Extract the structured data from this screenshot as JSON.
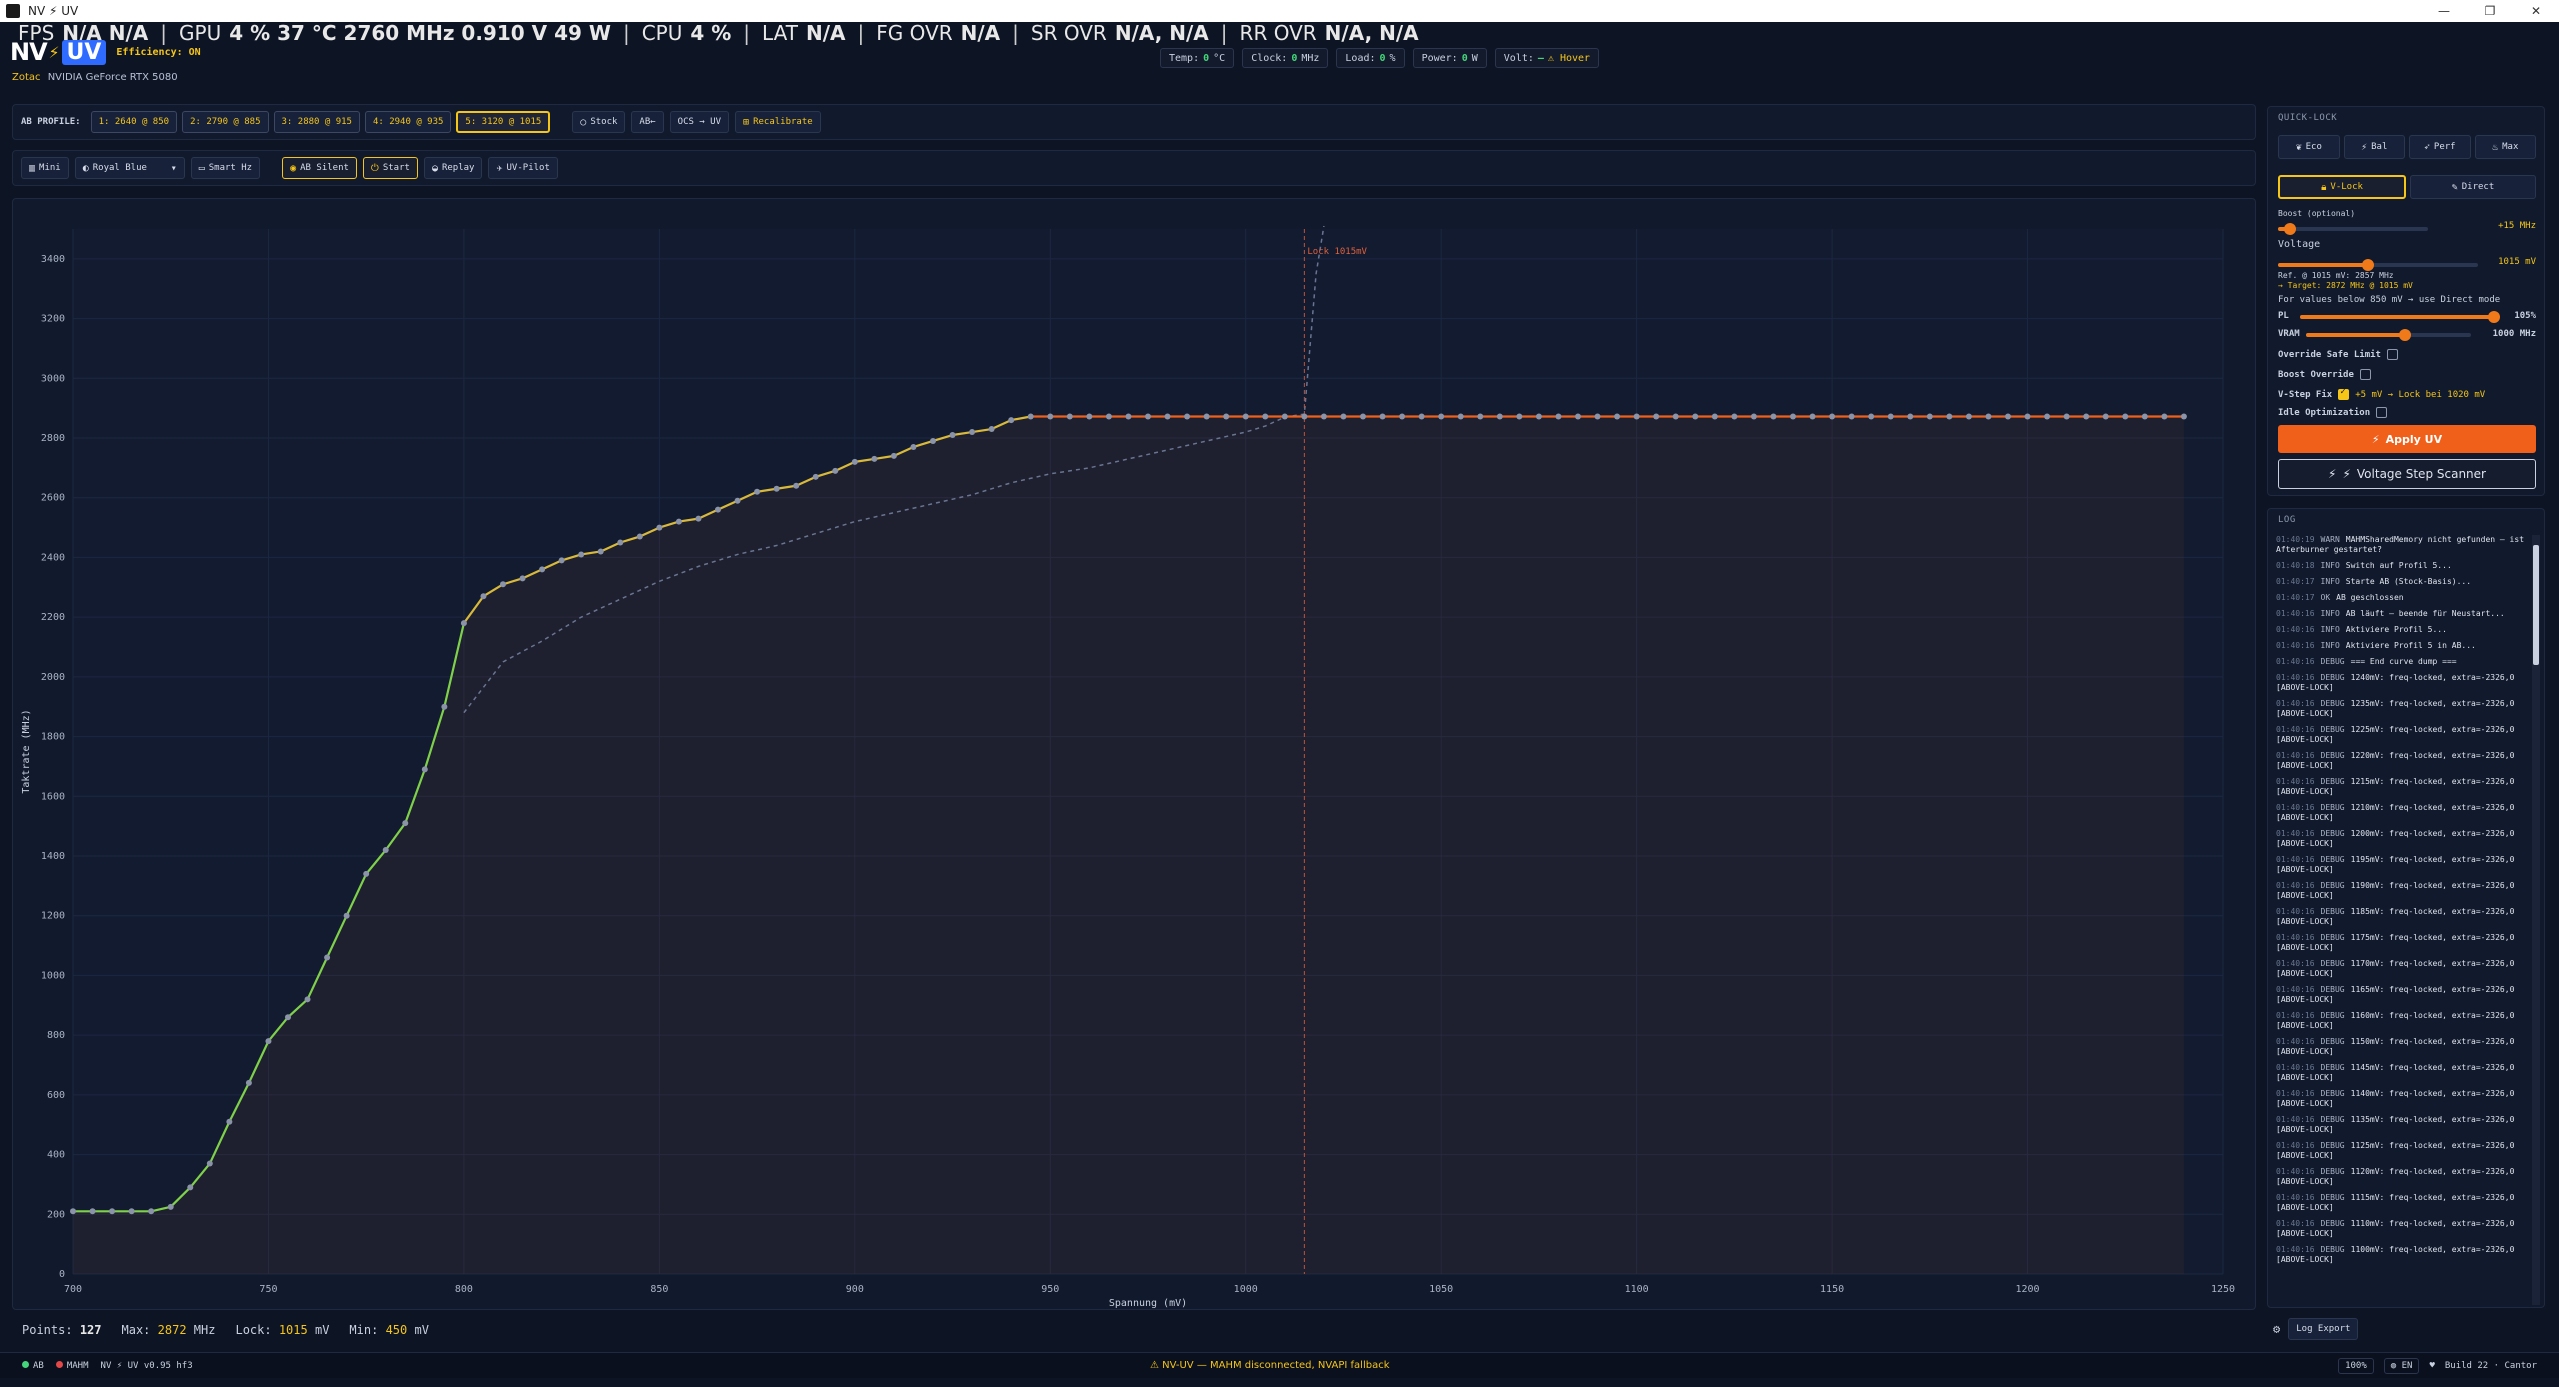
{
  "window": {
    "title": "NV ⚡ UV",
    "controls": [
      "—",
      "❐",
      "✕"
    ]
  },
  "osd": [
    {
      "label": "FPS",
      "value": "N/A  N/A"
    },
    {
      "label": "GPU",
      "value": "4 %  37 °C  2760 MHz  0.910 V  49 W"
    },
    {
      "label": "CPU",
      "value": "4 %"
    },
    {
      "label": "LAT",
      "value": "N/A"
    },
    {
      "label": "FG OVR",
      "value": "N/A"
    },
    {
      "label": "SR OVR",
      "value": "N/A, N/A"
    },
    {
      "label": "RR OVR",
      "value": "N/A, N/A"
    }
  ],
  "brand": {
    "nv": "NV",
    "bolt": "⚡",
    "uv": "UV",
    "efficiency": "Efficiency: ON",
    "vendor": "Zotac",
    "gpu": "NVIDIA GeForce RTX 5080"
  },
  "stats": [
    {
      "label": "Temp:",
      "value": "0",
      "unit": "°C"
    },
    {
      "label": "Clock:",
      "value": "0",
      "unit": "MHz"
    },
    {
      "label": "Load:",
      "value": "0",
      "unit": "%"
    },
    {
      "label": "Power:",
      "value": "0",
      "unit": "W"
    },
    {
      "label": "Volt:",
      "value": "—",
      "unit": "⚠ Hover"
    }
  ],
  "toolbar1": {
    "label": "AB PROFILE:",
    "profiles": [
      "1: 2640 @ 850",
      "2: 2790 @ 885",
      "3: 2880 @ 915",
      "4: 2940 @ 935",
      "5: 3120 @ 1015"
    ],
    "active_profile": 4,
    "stock": "Stock",
    "ab_arrow": "AB←",
    "ocs_uv": "OCS → UV",
    "recalibrate": "Recalibrate"
  },
  "toolbar2": {
    "mini": "Mini",
    "theme": "Royal Blue",
    "smart_hz": "Smart Hz",
    "ab_silent": "AB Silent",
    "start": "Start",
    "replay": "Replay",
    "uv_pilot": "UV-Pilot"
  },
  "chart_data": {
    "type": "line",
    "xlabel": "Spannung (mV)",
    "ylabel": "Taktrate (MHz)",
    "xlim": [
      700,
      1250
    ],
    "ylim": [
      0,
      3500
    ],
    "xticks": [
      700,
      750,
      800,
      850,
      900,
      950,
      1000,
      1050,
      1100,
      1150,
      1200,
      1250
    ],
    "yticks": [
      0,
      200,
      400,
      600,
      800,
      1000,
      1200,
      1400,
      1600,
      1800,
      2000,
      2200,
      2400,
      2600,
      2800,
      3000,
      3200,
      3400
    ],
    "lock_label": "Lock 1015mV",
    "lock_mv": 1015,
    "series": [
      {
        "x": [
          700,
          705,
          710,
          715,
          720,
          725,
          730,
          735,
          740,
          745,
          750,
          755,
          760,
          765,
          770,
          775,
          780,
          785,
          790,
          795,
          800,
          805,
          810,
          815,
          820,
          825,
          830,
          835,
          840,
          845,
          850,
          855,
          860,
          865,
          870,
          875,
          880,
          885,
          890,
          895,
          900,
          905,
          910,
          915,
          920,
          925,
          930,
          935,
          940,
          945,
          950,
          955,
          960,
          965,
          970,
          975,
          980,
          985,
          990,
          995,
          1000,
          1005,
          1010,
          1015,
          1020,
          1025,
          1030,
          1035,
          1040,
          1045,
          1050,
          1055,
          1060,
          1065,
          1070,
          1075,
          1080,
          1085,
          1090,
          1095,
          1100,
          1105,
          1110,
          1115,
          1120,
          1125,
          1130,
          1135,
          1140,
          1145,
          1150,
          1155,
          1160,
          1165,
          1170,
          1175,
          1180,
          1185,
          1190,
          1195,
          1200,
          1205,
          1210,
          1215,
          1220,
          1225,
          1230,
          1235,
          1240
        ],
        "values": [
          210,
          210,
          210,
          210,
          210,
          225,
          290,
          370,
          510,
          640,
          780,
          860,
          920,
          1060,
          1200,
          1340,
          1420,
          1510,
          1690,
          1900,
          2180,
          2270,
          2310,
          2330,
          2360,
          2390,
          2410,
          2420,
          2450,
          2470,
          2500,
          2520,
          2530,
          2560,
          2590,
          2620,
          2630,
          2640,
          2670,
          2690,
          2720,
          2730,
          2740,
          2770,
          2790,
          2810,
          2820,
          2830,
          2860,
          2872,
          2872,
          2872,
          2872,
          2872,
          2872,
          2872,
          2872,
          2872,
          2872,
          2872,
          2872,
          2872,
          2872,
          2872,
          2872,
          2872,
          2872,
          2872,
          2872,
          2872,
          2872,
          2872,
          2872,
          2872,
          2872,
          2872,
          2872,
          2872,
          2872,
          2872,
          2872,
          2872,
          2872,
          2872,
          2872,
          2872,
          2872,
          2872,
          2872,
          2872,
          2872,
          2872,
          2872,
          2872,
          2872,
          2872,
          2872,
          2872,
          2872,
          2872,
          2872,
          2872,
          2872,
          2872,
          2872,
          2872,
          2872,
          2872,
          2872
        ]
      },
      {
        "x": [
          800,
          810,
          820,
          830,
          840,
          850,
          860,
          870,
          880,
          890,
          900,
          910,
          920,
          930,
          940,
          950,
          960,
          970,
          980,
          990,
          1000,
          1005,
          1010,
          1015,
          1018,
          1020
        ],
        "values": [
          1880,
          2050,
          2120,
          2200,
          2260,
          2320,
          2370,
          2410,
          2440,
          2480,
          2520,
          2550,
          2580,
          2610,
          2650,
          2680,
          2700,
          2730,
          2760,
          2790,
          2820,
          2840,
          2870,
          2880,
          3350,
          3510
        ]
      }
    ],
    "grid": true
  },
  "chartstats": {
    "points_label": "Points:",
    "points": "127",
    "max_label": "Max:",
    "max": "2872",
    "max_unit": "MHz",
    "lock_label": "Lock:",
    "lock": "1015",
    "lock_unit": "mV",
    "min_label": "Min:",
    "min": "450",
    "min_unit": "mV"
  },
  "quicklock": {
    "title": "QUICK-LOCK",
    "modes": [
      "Eco",
      "Bal",
      "Perf",
      "Max"
    ],
    "vlock": "V-Lock",
    "direct": "Direct",
    "boost_label": "Boost (optional)",
    "boost_value": "+15 MHz",
    "boost_level": 0.08,
    "voltage_label": "Voltage",
    "voltage_value": "1015 mV",
    "voltage_level": 0.45,
    "ref_note": "Ref. @ 1015 mV: 2857 MHz",
    "target_note": "→ Target: 2872 MHz @ 1015 mV",
    "below_note": "For values below 850 mV → use Direct mode",
    "pl_label": "PL",
    "pl_value": "105%",
    "pl_level": 0.98,
    "vram_label": "VRAM",
    "vram_value": "1000 MHz",
    "vram_level": 0.6,
    "override_safe": "Override Safe Limit",
    "boost_override": "Boost Override",
    "vstep_fix": "V-Step Fix",
    "vstep_extra": "+5 mV → Lock bei 1020 mV",
    "idle_opt": "Idle Optimization",
    "apply": "Apply UV",
    "scanner": "Voltage Step Scanner"
  },
  "log": {
    "title": "LOG",
    "entries": [
      {
        "t": "01:40:19",
        "lv": "WARN",
        "msg": "MAHMSharedMemory nicht gefunden — ist Afterburner gestartet?"
      },
      {
        "t": "01:40:18",
        "lv": "INFO",
        "msg": "Switch auf Profil 5..."
      },
      {
        "t": "01:40:17",
        "lv": "INFO",
        "msg": "Starte AB (Stock-Basis)..."
      },
      {
        "t": "01:40:17",
        "lv": "OK",
        "msg": "AB geschlossen"
      },
      {
        "t": "01:40:16",
        "lv": "INFO",
        "msg": "AB läuft — beende für Neustart..."
      },
      {
        "t": "01:40:16",
        "lv": "INFO",
        "msg": "Aktiviere Profil 5..."
      },
      {
        "t": "01:40:16",
        "lv": "INFO",
        "msg": "Aktiviere Profil 5 in AB..."
      },
      {
        "t": "01:40:16",
        "lv": "DEBUG",
        "msg": "=== End curve dump ==="
      },
      {
        "t": "01:40:16",
        "lv": "DEBUG",
        "msg": "1240mV: freq-locked, extra=-2326,0 [ABOVE-LOCK]"
      },
      {
        "t": "01:40:16",
        "lv": "DEBUG",
        "msg": "1235mV: freq-locked, extra=-2326,0 [ABOVE-LOCK]"
      },
      {
        "t": "01:40:16",
        "lv": "DEBUG",
        "msg": "1225mV: freq-locked, extra=-2326,0 [ABOVE-LOCK]"
      },
      {
        "t": "01:40:16",
        "lv": "DEBUG",
        "msg": "1220mV: freq-locked, extra=-2326,0 [ABOVE-LOCK]"
      },
      {
        "t": "01:40:16",
        "lv": "DEBUG",
        "msg": "1215mV: freq-locked, extra=-2326,0 [ABOVE-LOCK]"
      },
      {
        "t": "01:40:16",
        "lv": "DEBUG",
        "msg": "1210mV: freq-locked, extra=-2326,0 [ABOVE-LOCK]"
      },
      {
        "t": "01:40:16",
        "lv": "DEBUG",
        "msg": "1200mV: freq-locked, extra=-2326,0 [ABOVE-LOCK]"
      },
      {
        "t": "01:40:16",
        "lv": "DEBUG",
        "msg": "1195mV: freq-locked, extra=-2326,0 [ABOVE-LOCK]"
      },
      {
        "t": "01:40:16",
        "lv": "DEBUG",
        "msg": "1190mV: freq-locked, extra=-2326,0 [ABOVE-LOCK]"
      },
      {
        "t": "01:40:16",
        "lv": "DEBUG",
        "msg": "1185mV: freq-locked, extra=-2326,0 [ABOVE-LOCK]"
      },
      {
        "t": "01:40:16",
        "lv": "DEBUG",
        "msg": "1175mV: freq-locked, extra=-2326,0 [ABOVE-LOCK]"
      },
      {
        "t": "01:40:16",
        "lv": "DEBUG",
        "msg": "1170mV: freq-locked, extra=-2326,0 [ABOVE-LOCK]"
      },
      {
        "t": "01:40:16",
        "lv": "DEBUG",
        "msg": "1165mV: freq-locked, extra=-2326,0 [ABOVE-LOCK]"
      },
      {
        "t": "01:40:16",
        "lv": "DEBUG",
        "msg": "1160mV: freq-locked, extra=-2326,0 [ABOVE-LOCK]"
      },
      {
        "t": "01:40:16",
        "lv": "DEBUG",
        "msg": "1150mV: freq-locked, extra=-2326,0 [ABOVE-LOCK]"
      },
      {
        "t": "01:40:16",
        "lv": "DEBUG",
        "msg": "1145mV: freq-locked, extra=-2326,0 [ABOVE-LOCK]"
      },
      {
        "t": "01:40:16",
        "lv": "DEBUG",
        "msg": "1140mV: freq-locked, extra=-2326,0 [ABOVE-LOCK]"
      },
      {
        "t": "01:40:16",
        "lv": "DEBUG",
        "msg": "1135mV: freq-locked, extra=-2326,0 [ABOVE-LOCK]"
      },
      {
        "t": "01:40:16",
        "lv": "DEBUG",
        "msg": "1125mV: freq-locked, extra=-2326,0 [ABOVE-LOCK]"
      },
      {
        "t": "01:40:16",
        "lv": "DEBUG",
        "msg": "1120mV: freq-locked, extra=-2326,0 [ABOVE-LOCK]"
      },
      {
        "t": "01:40:16",
        "lv": "DEBUG",
        "msg": "1115mV: freq-locked, extra=-2326,0 [ABOVE-LOCK]"
      },
      {
        "t": "01:40:16",
        "lv": "DEBUG",
        "msg": "1110mV: freq-locked, extra=-2326,0 [ABOVE-LOCK]"
      },
      {
        "t": "01:40:16",
        "lv": "DEBUG",
        "msg": "1100mV: freq-locked, extra=-2326,0 [ABOVE-LOCK]"
      }
    ],
    "export": "Log Export"
  },
  "statusbar": {
    "ab": "AB",
    "mahm": "MAHM",
    "version": "NV ⚡ UV v0.95 hf3",
    "warning": "⚠ NV-UV — MAHM disconnected, NVAPI fallback",
    "zoom": "100%",
    "lang": "EN",
    "build": "Build 22 · Cantor",
    "colors": {
      "ab": "#43d67a",
      "mahm": "#e24848"
    }
  }
}
